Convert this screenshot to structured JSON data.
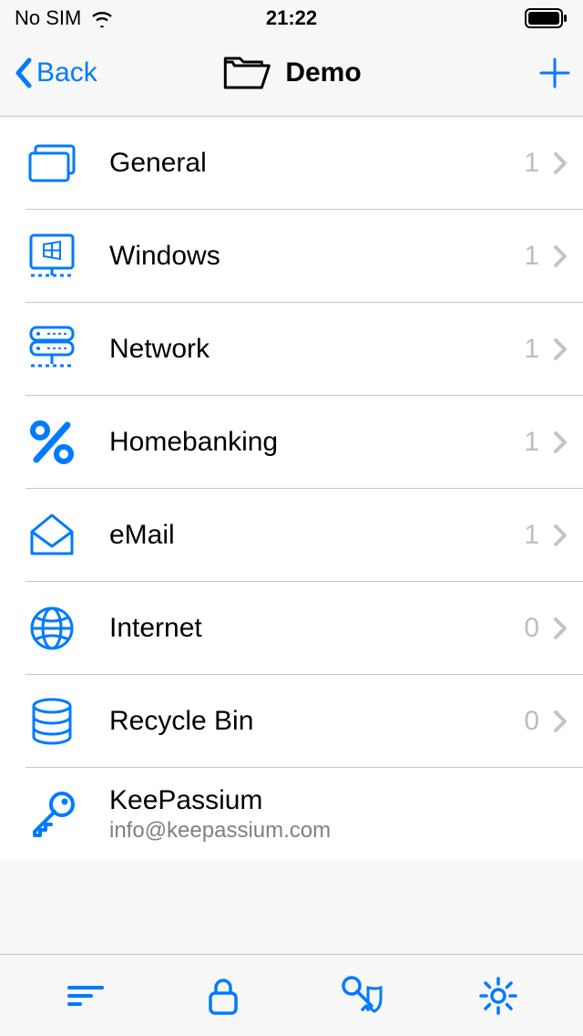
{
  "colors": {
    "accent": "#007aff",
    "secondary": "#808084",
    "chevron": "#c4c4c7"
  },
  "status": {
    "carrier": "No SIM",
    "time": "21:22"
  },
  "nav": {
    "back_label": "Back",
    "title": "Demo"
  },
  "rows": [
    {
      "icon": "folder-multiple-icon",
      "label": "General",
      "count": "1",
      "has_chevron": true
    },
    {
      "icon": "windows-icon",
      "label": "Windows",
      "count": "1",
      "has_chevron": true
    },
    {
      "icon": "server-icon",
      "label": "Network",
      "count": "1",
      "has_chevron": true
    },
    {
      "icon": "percent-icon",
      "label": "Homebanking",
      "count": "1",
      "has_chevron": true
    },
    {
      "icon": "envelope-icon",
      "label": "eMail",
      "count": "1",
      "has_chevron": true
    },
    {
      "icon": "globe-icon",
      "label": "Internet",
      "count": "0",
      "has_chevron": true
    },
    {
      "icon": "database-icon",
      "label": "Recycle Bin",
      "count": "0",
      "has_chevron": true
    },
    {
      "icon": "key-icon",
      "label": "KeePassium",
      "sub": "info@keepassium.com",
      "count": "",
      "has_chevron": false
    }
  ],
  "toolbar": {
    "sort": "sort-icon",
    "lock": "lock-icon",
    "keys": "key-shield-icon",
    "gear": "gear-icon"
  }
}
